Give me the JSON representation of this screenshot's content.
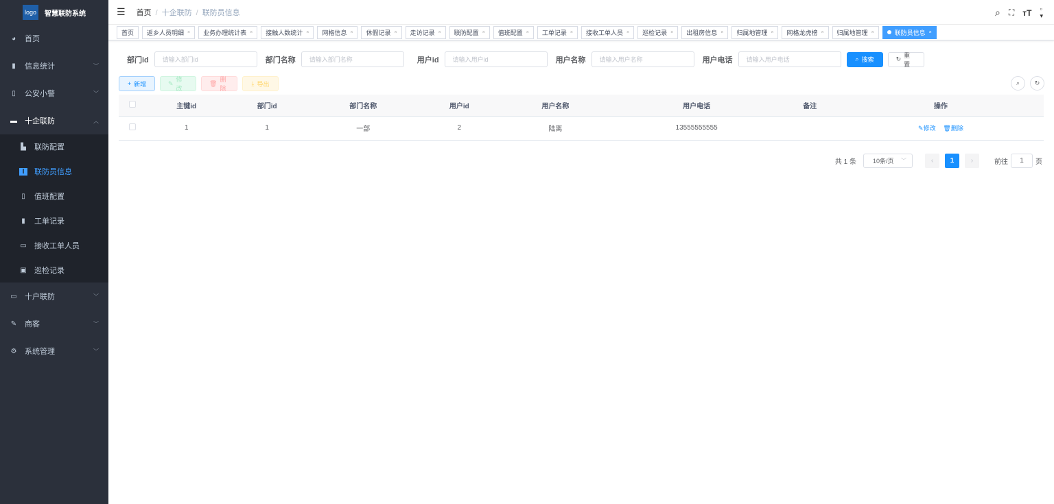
{
  "app": {
    "logo": "logo",
    "title": "智慧联防系统"
  },
  "sidebar": {
    "items": [
      {
        "label": "首页",
        "icon": "dashboard-icon"
      },
      {
        "label": "信息统计",
        "icon": "chart-icon"
      },
      {
        "label": "公安小警",
        "icon": "phone-icon"
      },
      {
        "label": "十企联防",
        "icon": "message-icon"
      },
      {
        "label": "十户联防",
        "icon": "monitor-icon"
      },
      {
        "label": "商客",
        "icon": "edit-icon"
      },
      {
        "label": "系统管理",
        "icon": "gear-icon"
      }
    ],
    "sub": [
      {
        "label": "联防配置"
      },
      {
        "label": "联防员信息"
      },
      {
        "label": "值班配置"
      },
      {
        "label": "工单记录"
      },
      {
        "label": "接收工单人员"
      },
      {
        "label": "巡检记录"
      }
    ]
  },
  "breadcrumb": [
    "首页",
    "十企联防",
    "联防员信息"
  ],
  "tags": [
    "首页",
    "返乡人员明细",
    "业务办理统计表",
    "接触人数统计",
    "网格信息",
    "休假记录",
    "走访记录",
    "联防配置",
    "值班配置",
    "工单记录",
    "接收工单人员",
    "巡检记录",
    "出租房信息",
    "归属地管理",
    "网格龙虎榜",
    "归属地管理",
    "联防员信息"
  ],
  "form": {
    "fields": [
      {
        "label": "部门id",
        "placeholder": "请输入部门id"
      },
      {
        "label": "部门名称",
        "placeholder": "请输入部门名称"
      },
      {
        "label": "用户id",
        "placeholder": "请输入用户id"
      },
      {
        "label": "用户名称",
        "placeholder": "请输入用户名称"
      },
      {
        "label": "用户电话",
        "placeholder": "请输入用户电话"
      }
    ],
    "search": "搜索",
    "reset": "重置"
  },
  "toolbar": {
    "add": "新增",
    "edit": "修改",
    "delete": "删除",
    "export": "导出"
  },
  "table": {
    "headers": [
      "主键id",
      "部门id",
      "部门名称",
      "用户id",
      "用户名称",
      "用户电话",
      "备注",
      "操作"
    ],
    "rows": [
      {
        "cells": [
          "1",
          "1",
          "一部",
          "2",
          "陆离",
          "13555555555",
          ""
        ],
        "edit": "修改",
        "delete": "删除"
      }
    ]
  },
  "pagination": {
    "total": "共 1 条",
    "size": "10条/页",
    "page": "1",
    "goto": "前往",
    "goto_value": "1",
    "unit": "页"
  },
  "colors": {
    "primary": "#1890ff",
    "sidebar": "#2b303b"
  }
}
